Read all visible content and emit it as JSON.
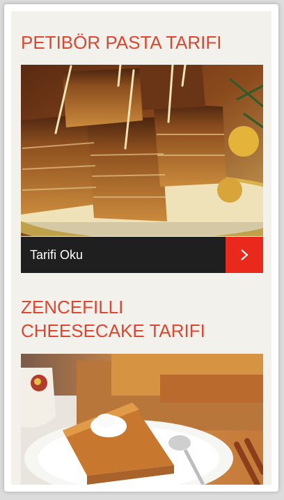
{
  "recipes": [
    {
      "title": "PETIBÖR PASTA TARIFI",
      "image_alt": "Petibör pasta",
      "cta_label": "Tarifi Oku",
      "cta_icon": "chevron-right-icon"
    },
    {
      "title": "ZENCEFILLI CHEESECAKE TARIFI",
      "image_alt": "Zencefilli cheesecake"
    }
  ],
  "colors": {
    "title": "#e0452f",
    "cta_background": "#1f1f1f",
    "cta_arrow_background": "#e8291c",
    "page_background": "#f3f1ec"
  }
}
